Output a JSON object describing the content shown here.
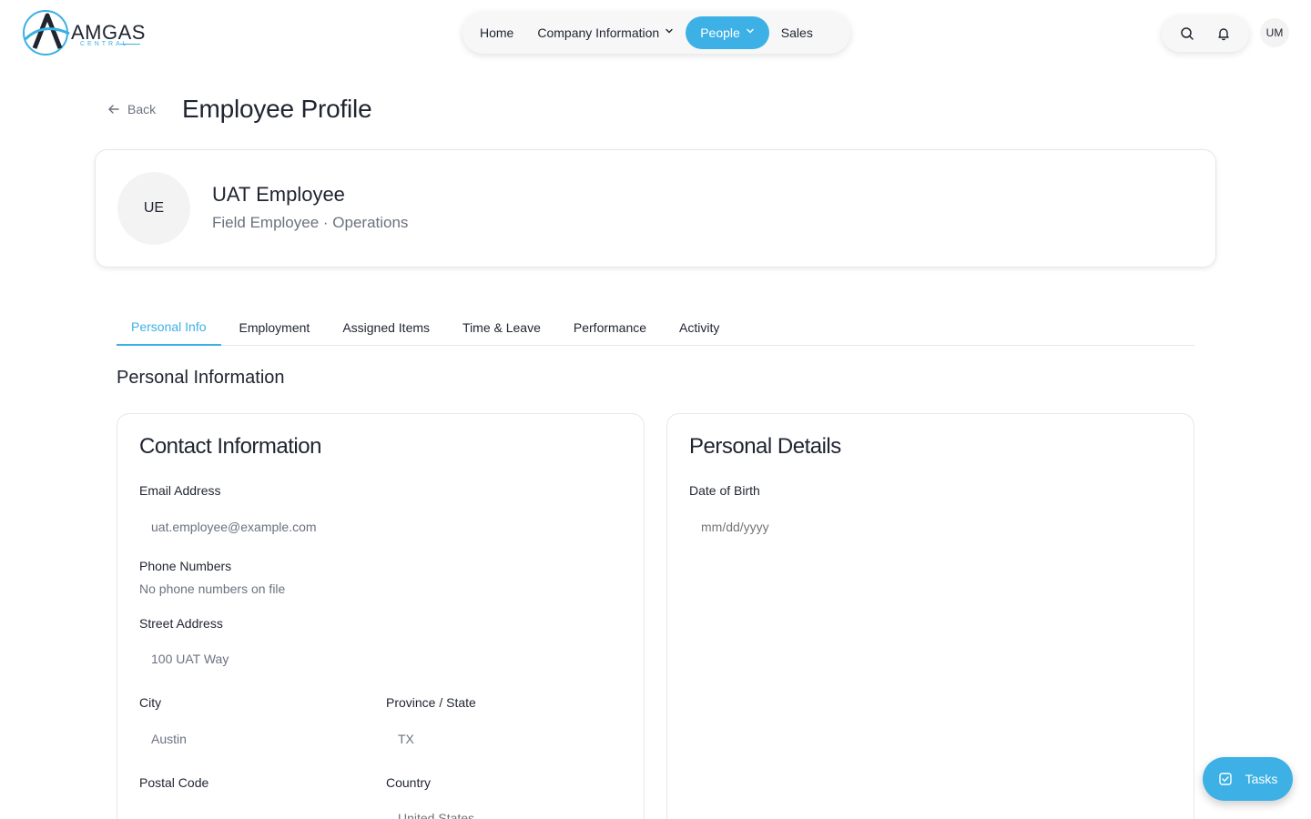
{
  "brand": {
    "name": "AMGAS",
    "sub": "CENTRAL"
  },
  "nav": {
    "items": [
      {
        "label": "Home"
      },
      {
        "label": "Company Information"
      },
      {
        "label": "People"
      },
      {
        "label": "Sales"
      }
    ]
  },
  "header": {
    "user_initials": "UM"
  },
  "page": {
    "back_label": "Back",
    "title": "Employee Profile"
  },
  "profile": {
    "initials": "UE",
    "name": "UAT Employee",
    "subtitle": "Field Employee · Operations"
  },
  "tabs": [
    {
      "label": "Personal Info"
    },
    {
      "label": "Employment"
    },
    {
      "label": "Assigned Items"
    },
    {
      "label": "Time & Leave"
    },
    {
      "label": "Performance"
    },
    {
      "label": "Activity"
    }
  ],
  "section": {
    "title": "Personal Information"
  },
  "contact": {
    "title": "Contact Information",
    "email_label": "Email Address",
    "email_value": "uat.employee@example.com",
    "phone_label": "Phone Numbers",
    "phone_note": "No phone numbers on file",
    "street_label": "Street Address",
    "street_value": "100 UAT Way",
    "city_label": "City",
    "city_value": "Austin",
    "province_label": "Province / State",
    "province_value": "TX",
    "postal_label": "Postal Code",
    "postal_value": "",
    "country_label": "Country",
    "country_value": "United States"
  },
  "details": {
    "title": "Personal Details",
    "dob_label": "Date of Birth",
    "dob_placeholder": "mm/dd/yyyy"
  },
  "fab": {
    "label": "Tasks"
  },
  "colors": {
    "accent": "#3db1e6",
    "text": "#1f2430",
    "muted": "#6b7280"
  }
}
